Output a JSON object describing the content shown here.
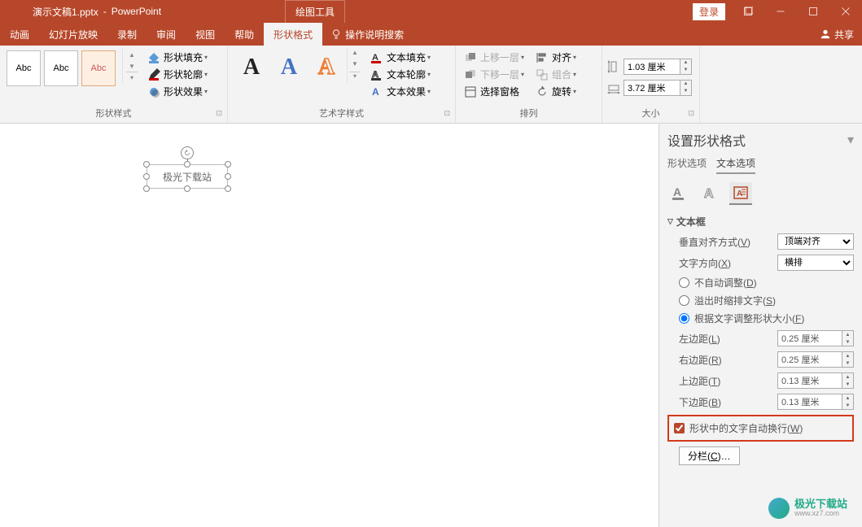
{
  "title": {
    "filename": "演示文稿1.pptx",
    "app": "PowerPoint",
    "contextTab": "绘图工具",
    "login": "登录"
  },
  "menu": {
    "anim": "动画",
    "slideshow": "幻灯片放映",
    "record": "录制",
    "review": "审阅",
    "view": "视图",
    "help": "帮助",
    "shapeFormat": "形状格式",
    "tellme": "操作说明搜索",
    "share": "共享"
  },
  "ribbon": {
    "abc": "Abc",
    "shapeFill": "形状填充",
    "shapeOutline": "形状轮廓",
    "shapeEffects": "形状效果",
    "shapeStyles": "形状样式",
    "artA": "A",
    "textFill": "文本填充",
    "textOutline": "文本轮廓",
    "textEffects": "文本效果",
    "wordArt": "艺术字样式",
    "bringFwd": "上移一层",
    "sendBack": "下移一层",
    "selPane": "选择窗格",
    "align": "对齐",
    "group": "组合",
    "rotate": "旋转",
    "arrange": "排列",
    "height": "1.03 厘米",
    "width": "3.72 厘米",
    "size": "大小"
  },
  "canvas": {
    "shapeText": "极光下载站"
  },
  "panel": {
    "title": "设置形状格式",
    "tabShape": "形状选项",
    "tabText": "文本选项",
    "section": "文本框",
    "vAlignLabel": "垂直对齐方式(V)",
    "vAlignVal": "顶端对齐",
    "textDirLabel": "文字方向(X)",
    "textDirVal": "横排",
    "noAutofit": "不自动调整(D)",
    "shrink": "溢出时缩排文字(S)",
    "resize": "根据文字调整形状大小(F)",
    "leftM": "左边距(L)",
    "rightM": "右边距(R)",
    "topM": "上边距(T)",
    "botM": "下边距(B)",
    "m025": "0.25 厘米",
    "m013": "0.13 厘米",
    "wrap": "形状中的文字自动换行(W)",
    "columns": "分栏(C)…"
  },
  "watermark": {
    "name": "极光下载站",
    "url": "www.xz7.com"
  }
}
